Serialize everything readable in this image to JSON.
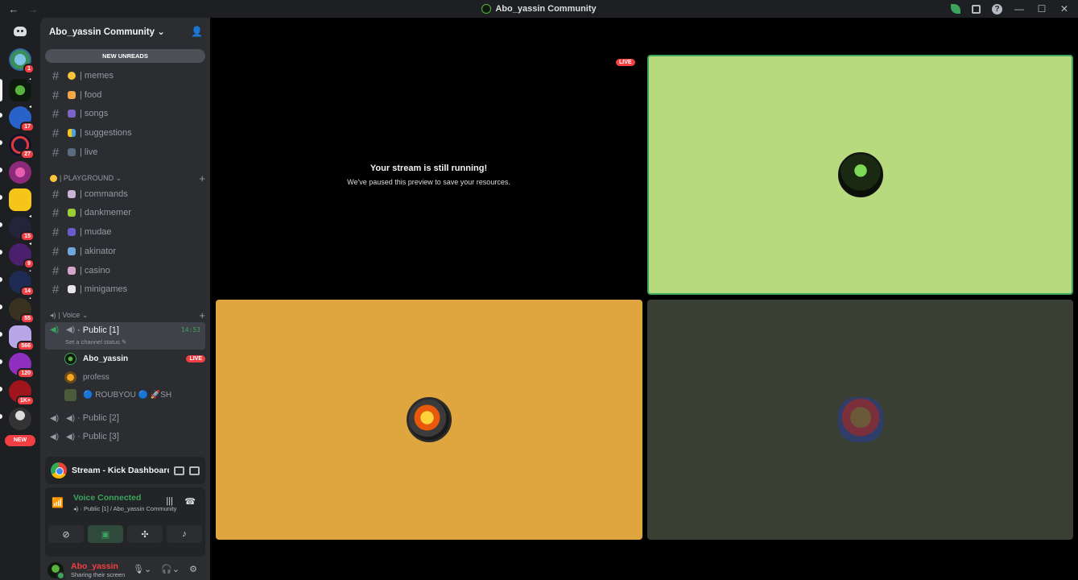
{
  "window": {
    "title": "Abo_yassin Community",
    "nav_back": "←",
    "nav_forward": "→",
    "minimize": "—",
    "maximize": "☐",
    "close": "✕",
    "help": "?"
  },
  "server_rail": {
    "badges": [
      "1",
      "17",
      "27",
      "15",
      "9",
      "14",
      "55",
      "566",
      "120",
      "1K+"
    ],
    "new_label": "NEW"
  },
  "guild": {
    "name": "Abo_yassin Community ⌄",
    "new_unreads": "NEW UNREADS",
    "channels_top": [
      "| memes",
      "| food",
      "| songs",
      "| suggestions",
      "| live"
    ],
    "category_playground": "| PLAYGROUND ⌄",
    "channels_playground": [
      "| commands",
      "| dankmemer",
      "| mudae",
      "| akinator",
      "| casino",
      "| minigames"
    ],
    "category_voice": "| Voice ⌄",
    "voice_channels": [
      {
        "name": "Public [1]",
        "time": "14:53",
        "status": "Set a channel status ✎"
      },
      {
        "name": "Public [2]"
      },
      {
        "name": "Public [3]"
      }
    ],
    "voice_users": [
      {
        "name": "Abo_yassin",
        "live": "LIVE"
      },
      {
        "name": "profess"
      },
      {
        "name": "🔵 ROUBYOU 🔵 🚀SH"
      }
    ]
  },
  "stream_panel": {
    "label": "Stream - Kick Dashboard - Go..."
  },
  "voice_panel": {
    "status": "Voice Connected",
    "location": "Public [1] / Abo_yassin Community"
  },
  "user": {
    "name": "Abo_yassin",
    "status": "Sharing their screen"
  },
  "stage": {
    "live_badge": "LIVE",
    "paused_title": "Your stream is still running!",
    "paused_subtitle": "We've paused this preview to save your resources.",
    "colors": {
      "speaking_tile": "#b7da7f",
      "speaking_border": "#3ba55c",
      "orange_tile": "#dfa63f",
      "dark_tile": "#3a3f33"
    }
  }
}
